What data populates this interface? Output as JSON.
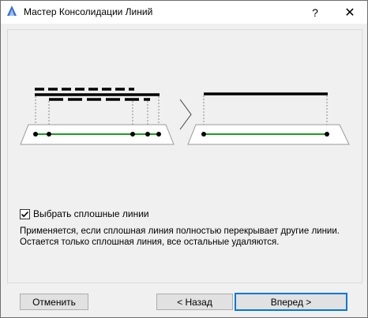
{
  "window": {
    "title": "Мастер Консолидации Линий",
    "help_label": "?",
    "close_label": "✕"
  },
  "options": {
    "solid_lines_checkbox_label": "Выбрать сплошные линии",
    "solid_lines_checked": true,
    "description_line1": "Применяется, если сплошная линия полностью перекрывает другие линии.",
    "description_line2": "Остается только сплошная линия, все остальные удаляются."
  },
  "buttons": {
    "cancel": "Отменить",
    "back": "< Назад",
    "next": "Вперед >"
  },
  "colors": {
    "accent": "#0078d7",
    "result_line": "#1a9e1a",
    "app_icon": "#3a6fd8"
  },
  "icons": {
    "app": "app-icon",
    "help": "help-icon",
    "close": "close-icon",
    "arrow": "chevron-right-icon"
  }
}
